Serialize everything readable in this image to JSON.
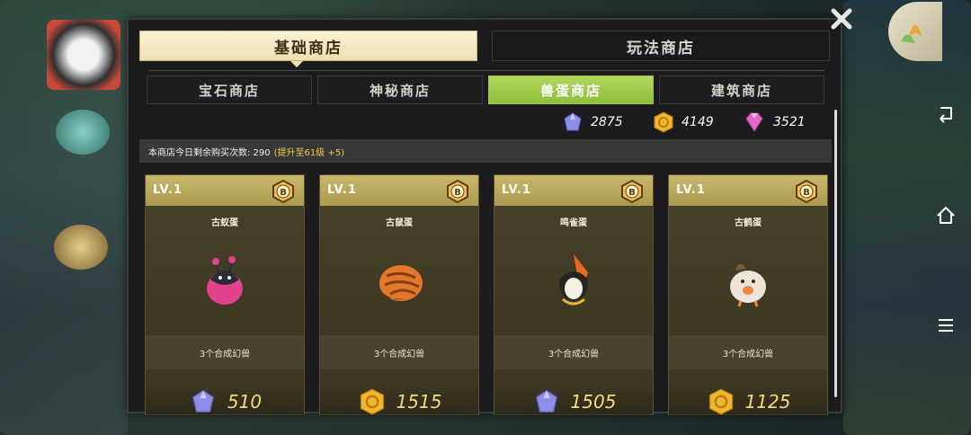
{
  "main_tabs": [
    {
      "label": "基础商店",
      "active": true
    },
    {
      "label": "玩法商店",
      "active": false
    }
  ],
  "sub_tabs": [
    {
      "label": "宝石商店",
      "active": false
    },
    {
      "label": "神秘商店",
      "active": false
    },
    {
      "label": "兽蛋商店",
      "active": true
    },
    {
      "label": "建筑商店",
      "active": false
    }
  ],
  "currencies": [
    {
      "icon": "crystal-icon",
      "value": "2875"
    },
    {
      "icon": "gold-coin-icon",
      "value": "4149"
    },
    {
      "icon": "pink-diamond-icon",
      "value": "3521"
    }
  ],
  "notice": {
    "text": "本商店今日剩余购买次数: 290",
    "highlight": "(提升至61级 +5)"
  },
  "items": [
    {
      "level": "LV.1",
      "badge": "B",
      "name": "古蚁蛋",
      "desc": "3个合成幻兽",
      "price_icon": "crystal-icon",
      "price": "510",
      "egg_icon": "pink-bug-egg-icon"
    },
    {
      "level": "LV.1",
      "badge": "B",
      "name": "古鼠蛋",
      "desc": "3个合成幻兽",
      "price_icon": "gold-coin-icon",
      "price": "1515",
      "egg_icon": "striped-orange-egg-icon"
    },
    {
      "level": "LV.1",
      "badge": "B",
      "name": "鸣雀蛋",
      "desc": "3个合成幻兽",
      "price_icon": "crystal-icon",
      "price": "1505",
      "egg_icon": "bird-feather-egg-icon"
    },
    {
      "level": "LV.1",
      "badge": "B",
      "name": "古鹤蛋",
      "desc": "3个合成幻兽",
      "price_icon": "gold-coin-icon",
      "price": "1125",
      "egg_icon": "white-bird-egg-icon"
    }
  ],
  "colors": {
    "active_tab": "#efe0b0",
    "active_subtab": "#9fcb4a",
    "card_header": "#c9b76a",
    "price_text": "#f4dc7a",
    "notice_highlight": "#f0c94d"
  }
}
